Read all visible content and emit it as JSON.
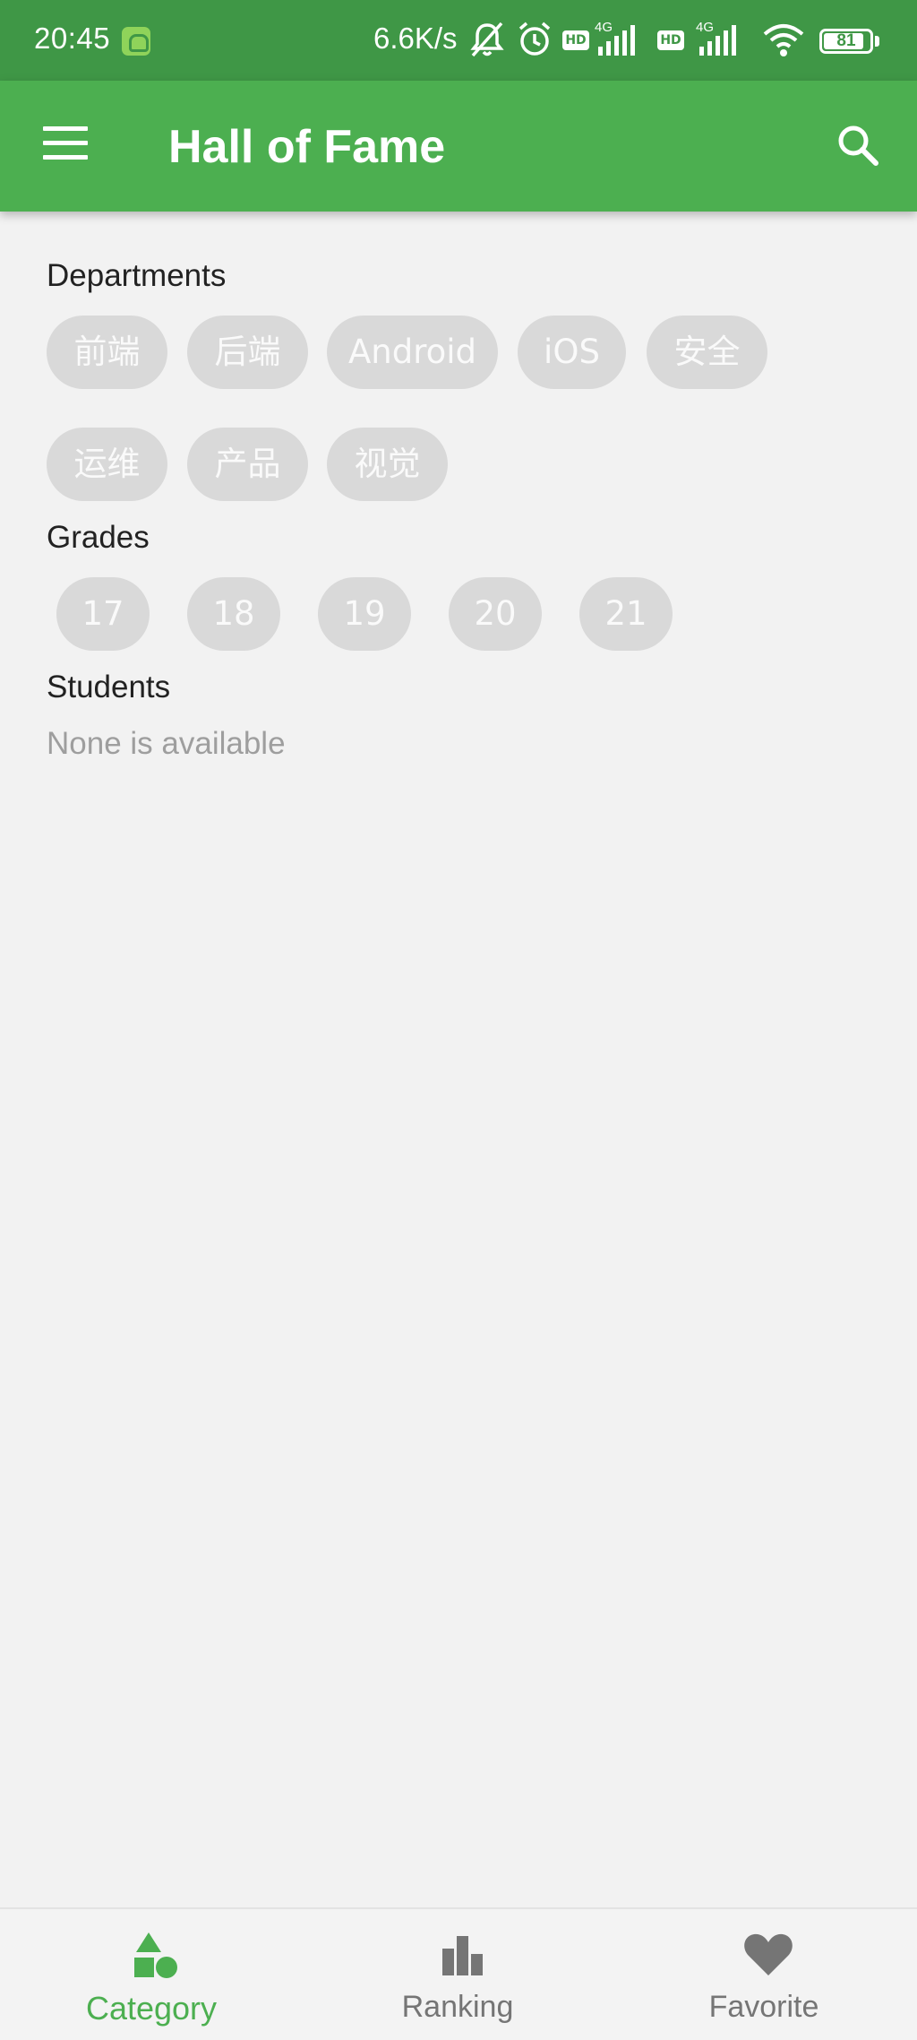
{
  "status_bar": {
    "time": "20:45",
    "net_speed": "6.6K/s",
    "sig1_label": "4G",
    "sig2_label": "4G",
    "hd": "HD",
    "battery": "81",
    "icons": [
      "app-icon",
      "mute-icon",
      "alarm-icon",
      "hd-icon",
      "signal-icon",
      "hd-icon",
      "signal-icon",
      "wifi-icon",
      "battery-icon"
    ]
  },
  "app_bar": {
    "title": "Hall of Fame",
    "menu_icon": "menu-icon",
    "search_icon": "search-icon",
    "color": "#4caf50"
  },
  "departments": {
    "title": "Departments",
    "chips": [
      "前端",
      "后端",
      "Android",
      "iOS",
      "安全",
      "运维",
      "产品",
      "视觉"
    ]
  },
  "grades": {
    "title": "Grades",
    "chips": [
      "17",
      "18",
      "19",
      "20",
      "21"
    ]
  },
  "students": {
    "title": "Students",
    "empty_text": "None is available"
  },
  "bottom_nav": {
    "items": [
      {
        "label": "Category",
        "icon": "category-icon",
        "active": true
      },
      {
        "label": "Ranking",
        "icon": "ranking-icon",
        "active": false
      },
      {
        "label": "Favorite",
        "icon": "heart-icon",
        "active": false
      }
    ],
    "active_color": "#4caf50",
    "inactive_color": "#757575"
  }
}
